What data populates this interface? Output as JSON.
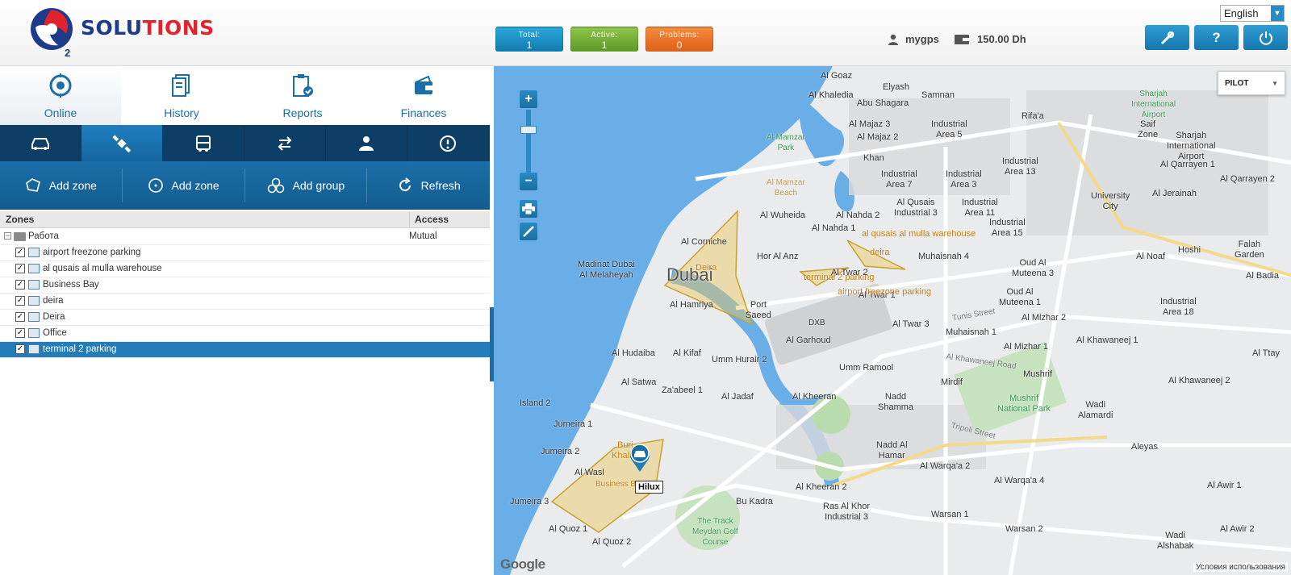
{
  "header": {
    "logo": {
      "brand_part1": "SOLU",
      "brand_part2": "TIONS",
      "subscript": "2"
    },
    "stats": [
      {
        "label": "Total:",
        "value": "1"
      },
      {
        "label": "Active:",
        "value": "1"
      },
      {
        "label": "Problems:",
        "value": "0"
      }
    ],
    "user": "mygps",
    "balance": "150.00 Dh",
    "language": "English",
    "buttons": {
      "settings_icon": "wrench-screwdriver-icon",
      "help_label": "?",
      "power_icon": "power-icon"
    }
  },
  "nav": {
    "tabs": [
      {
        "label": "Online",
        "icon": "target-icon"
      },
      {
        "label": "History",
        "icon": "documents-icon"
      },
      {
        "label": "Reports",
        "icon": "clipboard-check-icon"
      },
      {
        "label": "Finances",
        "icon": "wallet-icon"
      }
    ],
    "subtabs": [
      "car-icon",
      "satellite-icon",
      "bus-icon",
      "swap-arrows-icon",
      "driver-icon",
      "alert-icon"
    ]
  },
  "toolbar": {
    "buttons": [
      {
        "label": "Add zone",
        "icon": "polygon-zone-icon"
      },
      {
        "label": "Add zone",
        "icon": "circle-zone-icon"
      },
      {
        "label": "Add group",
        "icon": "group-icon"
      },
      {
        "label": "Refresh",
        "icon": "refresh-icon"
      }
    ]
  },
  "zones_table": {
    "headers": {
      "zones": "Zones",
      "access": "Access"
    },
    "root": {
      "name": "Работа",
      "access": "Mutual",
      "expander": "−"
    },
    "items": [
      {
        "name": "airport freezone parking",
        "checked": true,
        "selected": false
      },
      {
        "name": "al qusais al mulla warehouse",
        "checked": true,
        "selected": false
      },
      {
        "name": "Business Bay",
        "checked": true,
        "selected": false
      },
      {
        "name": "deira",
        "checked": true,
        "selected": false
      },
      {
        "name": "Deira",
        "checked": true,
        "selected": false
      },
      {
        "name": "Office",
        "checked": true,
        "selected": false
      },
      {
        "name": "terminal 2 parking",
        "checked": true,
        "selected": true
      }
    ],
    "check_mark": "✓"
  },
  "map": {
    "map_type": "PILOT",
    "zoom_in": "+",
    "zoom_out": "−",
    "collapse_arrow": "◀",
    "vehicle_label": "Hilux",
    "google": "Google",
    "terms": "Условия использования",
    "labels": {
      "dubai": "Dubai",
      "al_goaz": "Al Goaz",
      "elyash": "Elyash",
      "al_khaledia": "Al Khaledia",
      "abu_shagara": "Abu Shagara",
      "samnan": "Samnan",
      "sharjah_airport": "Sharjah\nInternational\nAirport",
      "rifaa": "Rifa'a",
      "al_majaz3": "Al Majaz 3",
      "industrial5": "Industrial\nArea 5",
      "saif_zone": "Saif\nZone",
      "sharjah_airport2": "Sharjah\nInternational\nAirport",
      "al_mamzar_park": "Al Mamzar\nPark",
      "al_majaz2": "Al Majaz 2",
      "khan": "Khan",
      "al_qarrayen1": "Al Qarrayen 1",
      "industrial13": "Industrial\nArea 13",
      "al_qarrayen2": "Al Qarrayen 2",
      "industrial7": "Industrial\nArea 7",
      "industrial3": "Industrial\nArea 3",
      "al_mamzar_beach": "Al Mamzar\nBeach",
      "university_city": "University\nCity",
      "al_jeraina": "Al Jerainah",
      "al_qusais_ind3": "Al Qusais\nIndustrial 3",
      "industrial11": "Industrial\nArea 11",
      "al_wuheida": "Al Wuheida",
      "al_nahda2": "Al Nahda 2",
      "industrial15": "Industrial\nArea 15",
      "al_nahda1": "Al Nahda 1",
      "al_corniche": "Al Corniche",
      "al_qusais_warehouse": "al qusais al mulla warehouse",
      "falah_garden": "Falah\nGarden",
      "hoshi": "Hoshi",
      "deira_small": "deira",
      "muhaisnah4": "Muhaisnah 4",
      "al_noaf": "Al Noaf",
      "madinat_dubai": "Madinat Dubai\nAl Melaheyah",
      "deira_zone": "Deira",
      "hor_al_anz": "Hor Al Anz",
      "terminal_parking": "terminal 2 parking",
      "al_twar2": "Al Twar 2",
      "oud_al_muteena3": "Oud Al\nMuteena 3",
      "al_badia": "Al Badia",
      "al_twar1": "Al Twar 1",
      "airport_freezone": "airport freezone parking",
      "oud_al_muteena1": "Oud Al\nMuteena 1",
      "al_hamriya": "Al Hamriya",
      "port_saeed": "Port\nSaeed",
      "dxb": "DXB",
      "tunis_street": "Tunis Street",
      "industrial18": "Industrial\nArea 18",
      "al_twar3": "Al Twar 3",
      "al_mizhar2": "Al Mizhar 2",
      "al_garhoud": "Al Garhoud",
      "muhaisnah1": "Muhaisnah 1",
      "al_hudaiba": "Al Hudaiba",
      "al_kifaf": "Al Kifaf",
      "umm_hurair2": "Umm Hurair 2",
      "al_mizhar1": "Al Mizhar 1",
      "al_khawaneej1": "Al Khawaneej 1",
      "al_ttay": "Al Ttay",
      "al_khawaneej_road": "Al Khawaneej Road",
      "umm_ramool": "Umm Ramool",
      "al_satwa": "Al Satwa",
      "mirdif": "Mirdif",
      "mushrif": "Mushrif",
      "al_khawaneej2": "Al Khawaneej 2",
      "zabeel1": "Za'abeel 1",
      "island2": "Island 2",
      "al_jadaf": "Al Jadaf",
      "al_kheeran": "Al Kheeran",
      "nadd_shamma": "Nadd\nShamma",
      "mushrif_park": "Mushrif\nNational Park",
      "wadi_alamardi": "Wadi\nAlamardi",
      "jumeira1": "Jumeira 1",
      "tripoli_street": "Tripoli Street",
      "burj_khalifa": "Burj\nKhalifa",
      "jumeira2": "Jumeira 2",
      "aleyas": "Aleyas",
      "nadd_al_hamar": "Nadd Al\nHamar",
      "al_wasl": "Al Wasl",
      "business_bay": "Business Bay",
      "al_warqaa2": "Al Warqa'a 2",
      "al_warqaa4": "Al Warqa'a 4",
      "al_kheeran2": "Al Kheeran 2",
      "al_awir1": "Al Awir 1",
      "jumeira3": "Jumeira 3",
      "bu_kadra": "Bu Kadra",
      "ras_al_khor": "Ras Al Khor\nIndustrial 3",
      "warsan1": "Warsan 1",
      "al_quoz1": "Al Quoz 1",
      "the_track": "The Track\nMeydan Golf\nCourse",
      "warsan2": "Warsan 2",
      "al_awir2": "Al Awir 2",
      "al_quoz2": "Al Quoz 2",
      "wadi_alshabak": "Wadi\nAlshabak"
    }
  }
}
